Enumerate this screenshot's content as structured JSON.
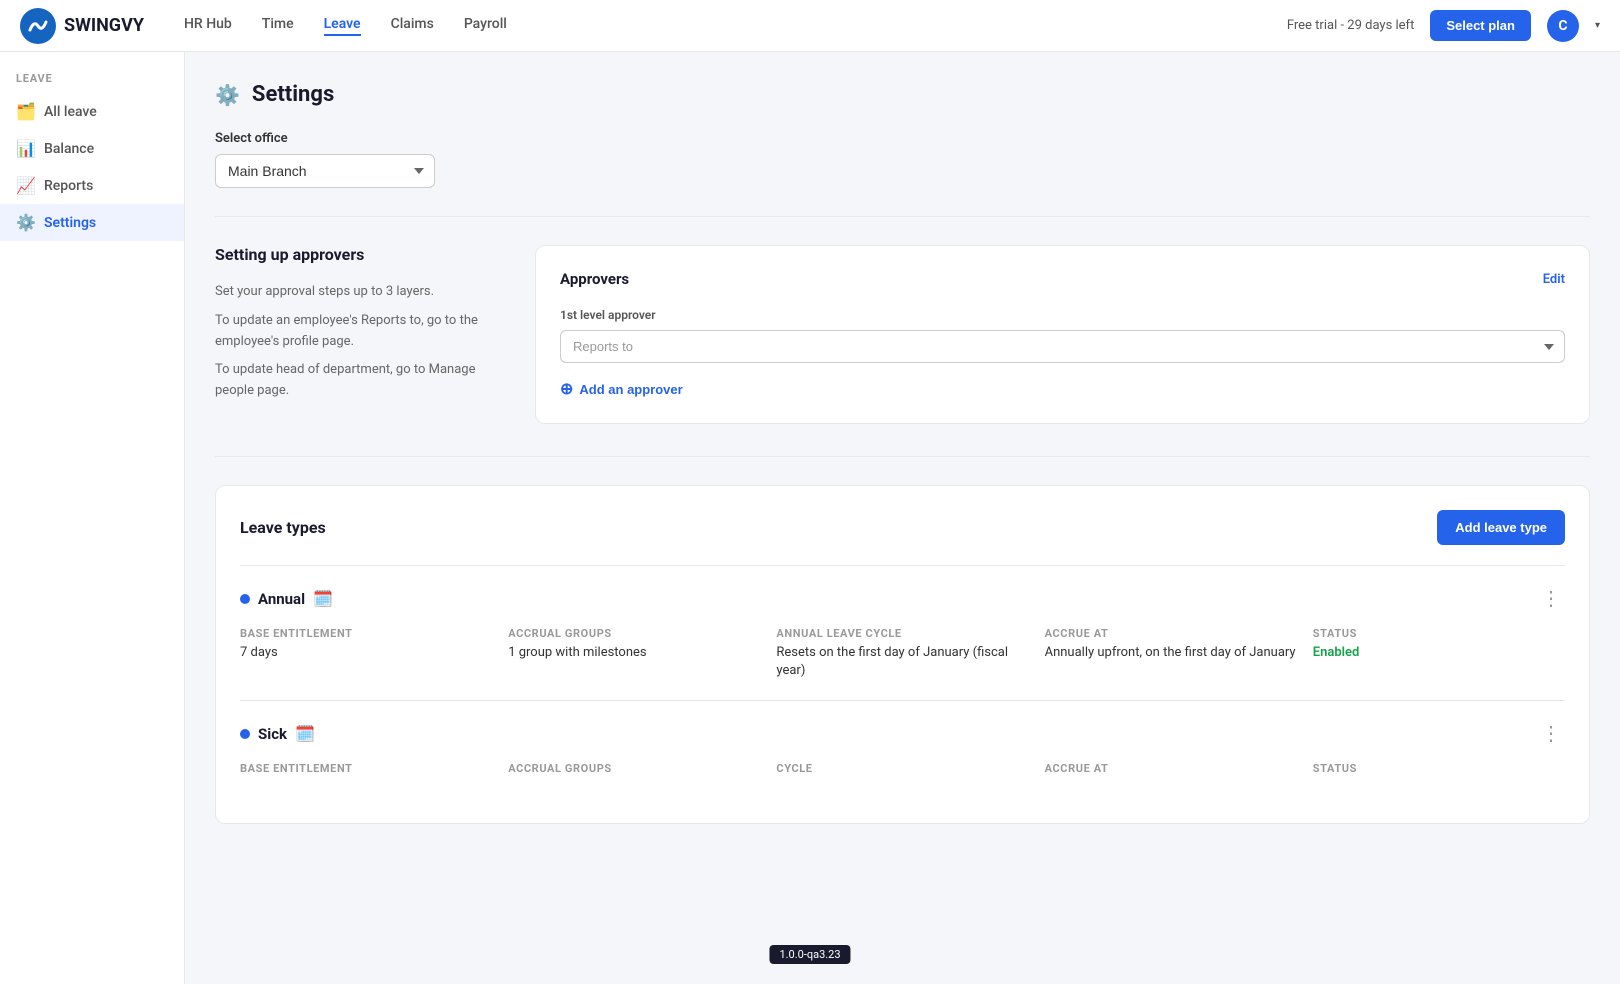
{
  "topnav": {
    "logo_text": "SWINGVY",
    "nav_links": [
      {
        "label": "HR Hub",
        "active": false
      },
      {
        "label": "Time",
        "active": false
      },
      {
        "label": "Leave",
        "active": true
      },
      {
        "label": "Claims",
        "active": false
      },
      {
        "label": "Payroll",
        "active": false
      }
    ],
    "trial_text": "Free trial - 29 days left",
    "select_plan_label": "Select plan",
    "avatar_letter": "C"
  },
  "sidebar": {
    "section_label": "LEAVE",
    "items": [
      {
        "label": "All leave",
        "icon": "📋",
        "active": false
      },
      {
        "label": "Balance",
        "icon": "📊",
        "active": false
      },
      {
        "label": "Reports",
        "icon": "📈",
        "active": false
      },
      {
        "label": "Settings",
        "icon": "⚙️",
        "active": true
      }
    ]
  },
  "page": {
    "title": "Settings",
    "gear_icon": "⚙️"
  },
  "select_office": {
    "label": "Select office",
    "value": "Main Branch",
    "options": [
      "Main Branch"
    ]
  },
  "approvers_section": {
    "left": {
      "title": "Setting up approvers",
      "desc_line1": "Set your approval steps up to 3 layers.",
      "desc_line2": "To update an employee's Reports to, go to the employee's profile page.",
      "desc_line3": "To update head of department, go to Manage people page."
    },
    "card": {
      "title": "Approvers",
      "edit_label": "Edit",
      "level_label": "1st level approver",
      "select_placeholder": "Reports to",
      "add_approver_label": "Add an approver"
    }
  },
  "leave_types_section": {
    "title": "Leave types",
    "add_button_label": "Add leave type",
    "items": [
      {
        "name": "Annual",
        "emoji": "🗓️",
        "dot_color": "blue",
        "base_entitlement_label": "BASE ENTITLEMENT",
        "base_entitlement_value": "7 days",
        "accrual_groups_label": "ACCRUAL GROUPS",
        "accrual_groups_value": "1 group with milestones",
        "annual_cycle_label": "ANNUAL LEAVE CYCLE",
        "annual_cycle_value": "Resets on the first day of January (fiscal year)",
        "accrue_at_label": "ACCRUE AT",
        "accrue_at_value": "Annually upfront, on the first day of January",
        "status_label": "STATUS",
        "status_value": "Enabled"
      },
      {
        "name": "Sick",
        "emoji": "🗓️",
        "dot_color": "blue",
        "base_entitlement_label": "BASE ENTITLEMENT",
        "base_entitlement_value": "",
        "accrual_groups_label": "ACCRUAL GROUPS",
        "accrual_groups_value": "",
        "annual_cycle_label": "CYCLE",
        "annual_cycle_value": "",
        "accrue_at_label": "ACCRUE AT",
        "accrue_at_value": "",
        "status_label": "STATUS",
        "status_value": ""
      }
    ]
  },
  "version_badge": "1.0.0-qa3.23"
}
